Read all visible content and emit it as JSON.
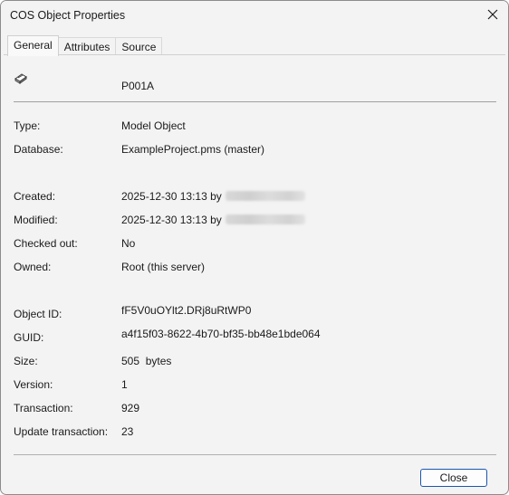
{
  "window": {
    "title": "COS Object Properties",
    "close_icon": "close-icon"
  },
  "tabs": [
    {
      "label": "General",
      "active": true
    },
    {
      "label": "Attributes",
      "active": false
    },
    {
      "label": "Source",
      "active": false
    }
  ],
  "object": {
    "icon": "model-object-icon",
    "name": "P001A"
  },
  "details": {
    "type_label": "Type:",
    "type_value": "Model Object",
    "database_label": "Database:",
    "database_value": "ExampleProject.pms (master)"
  },
  "history": {
    "created_label": "Created:",
    "created_value": "2025-12-30 13:13 by",
    "modified_label": "Modified:",
    "modified_value": "2025-12-30 13:13 by",
    "checked_out_label": "Checked out:",
    "checked_out_value": "No",
    "owned_label": "Owned:",
    "owned_value": "Root (this server)"
  },
  "identity": {
    "object_id_label": "Object ID:",
    "object_id_value": "fF5V0uOYlt2.DRj8uRtWP0",
    "guid_label": "GUID:",
    "guid_value": "a4f15f03-8622-4b70-bf35-bb48e1bde064",
    "size_label": "Size:",
    "size_value": "505  bytes",
    "version_label": "Version:",
    "version_value": "1",
    "transaction_label": "Transaction:",
    "transaction_value": "929",
    "update_transaction_label": "Update transaction:",
    "update_transaction_value": "23"
  },
  "footer": {
    "close_label": "Close"
  }
}
